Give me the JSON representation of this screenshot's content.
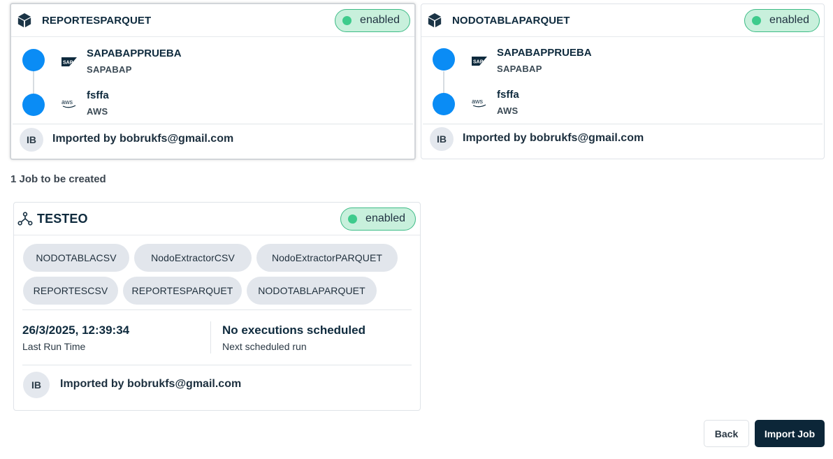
{
  "pipelines": [
    {
      "title": "REPORTESPARQUET",
      "status": "enabled",
      "steps": [
        {
          "name": "SAPABAPPRUEBA",
          "type": "SAPABAP",
          "logo": "sap-logo-icon"
        },
        {
          "name": "fsffa",
          "type": "AWS",
          "logo": "aws-logo-icon"
        }
      ],
      "avatar": "IB",
      "imported_by": "Imported by bobrukfs@gmail.com"
    },
    {
      "title": "NODOTABLAPARQUET",
      "status": "enabled",
      "steps": [
        {
          "name": "SAPABAPPRUEBA",
          "type": "SAPABAP",
          "logo": "sap-logo-icon"
        },
        {
          "name": "fsffa",
          "type": "AWS",
          "logo": "aws-logo-icon"
        }
      ],
      "avatar": "IB",
      "imported_by": "Imported by bobrukfs@gmail.com"
    }
  ],
  "jobs_label": "1 Job to be created",
  "job": {
    "title": "TESTEO",
    "status": "enabled",
    "chips": [
      "NODOTABLACSV",
      "NodoExtractorCSV",
      "NodoExtractorPARQUET",
      "REPORTESCSV",
      "REPORTESPARQUET",
      "NODOTABLAPARQUET"
    ],
    "last_run_value": "26/3/2025, 12:39:34",
    "last_run_label": "Last Run Time",
    "next_run_value": "No executions scheduled",
    "next_run_label": "Next scheduled run",
    "avatar": "IB",
    "imported_by": "Imported by bobrukfs@gmail.com"
  },
  "buttons": {
    "back": "Back",
    "import": "Import Job"
  },
  "colors": {
    "accent_green": "#3ecb8c",
    "toggle_bg": "#c8f0dc",
    "node_blue": "#0a8cf5",
    "primary_dark": "#0c2638"
  }
}
